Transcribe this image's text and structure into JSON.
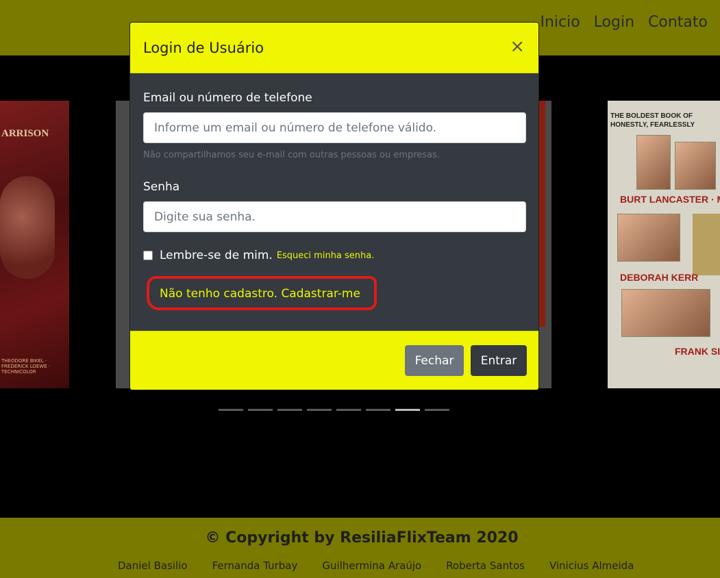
{
  "navbar": {
    "links": [
      {
        "label": "Inicio"
      },
      {
        "label": "Login"
      },
      {
        "label": "Contato"
      }
    ]
  },
  "carousel": {
    "left_poster": {
      "top_text": "ARRISON",
      "credits": "THEODORE BIKEL · FREDERICK LOEWE · TECHNICOLOR"
    },
    "right_poster": {
      "title": "THE BOLDEST BOOK OF HONESTLY, FEARLESSLY",
      "actor1": "BURT LANCASTER · MO",
      "actor2": "DEBORAH KERR",
      "actor3": "FRANK SINA"
    },
    "indicator_count": 8,
    "active_indicator": 7
  },
  "modal": {
    "title": "Login de Usuário",
    "close_symbol": "×",
    "email_label": "Email ou número de telefone",
    "email_placeholder": "Informe um email ou número de telefone válido.",
    "email_help": "Não compartilhamos seu e-mail com outras pessoas ou empresas.",
    "password_label": "Senha",
    "password_placeholder": "Digite sua senha.",
    "remember_label": "Lembre-se de mim.",
    "forgot_link": "Esqueci minha senha.",
    "register_link": "Não tenho cadastro. Cadastrar-me",
    "close_button": "Fechar",
    "enter_button": "Entrar"
  },
  "footer": {
    "copyright": "© Copyright by ResiliaFlixTeam 2020",
    "team": [
      "Daniel Basilio",
      "Fernanda Turbay",
      "Guilhermina Araújo",
      "Roberta Santos",
      "Vinicius Almeida"
    ]
  },
  "colors": {
    "accent": "#f0f500",
    "navbar_dimmed": "#7a7a00",
    "modal_body": "#343a40",
    "annotation": "#e01b1b"
  }
}
